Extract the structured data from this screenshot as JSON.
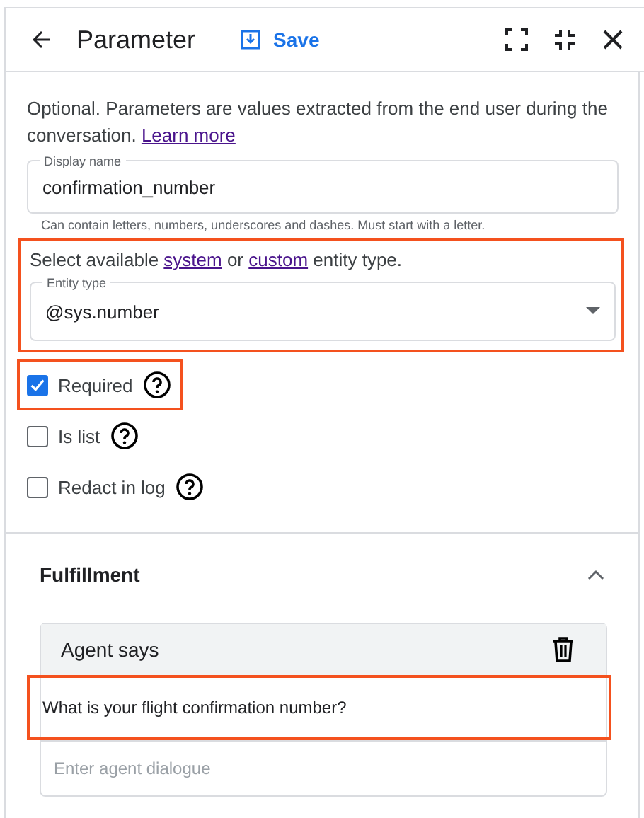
{
  "header": {
    "title": "Parameter",
    "save_label": "Save"
  },
  "intro": {
    "text": "Optional. Parameters are values extracted from the end user during the conversation.",
    "link": "Learn more"
  },
  "display_name": {
    "label": "Display name",
    "value": "confirmation_number",
    "hint": "Can contain letters, numbers, underscores and dashes. Must start with a letter."
  },
  "entity": {
    "highlighted": true,
    "before": "Select available",
    "link_1": "system",
    "middle": "or",
    "link_2": "custom",
    "after": "entity type.",
    "label": "Entity type",
    "value": "@sys.number"
  },
  "options": [
    {
      "label": "Required",
      "checked": true,
      "highlighted": true
    },
    {
      "label": "Is list",
      "checked": false,
      "highlighted": false
    },
    {
      "label": "Redact in log",
      "checked": false,
      "highlighted": false
    }
  ],
  "fulfillment": {
    "title": "Fulfillment",
    "expanded": true,
    "card_title": "Agent says",
    "messages": [
      {
        "text": "What is your flight confirmation number?",
        "highlighted": true
      }
    ],
    "placeholder": "Enter agent dialogue"
  }
}
